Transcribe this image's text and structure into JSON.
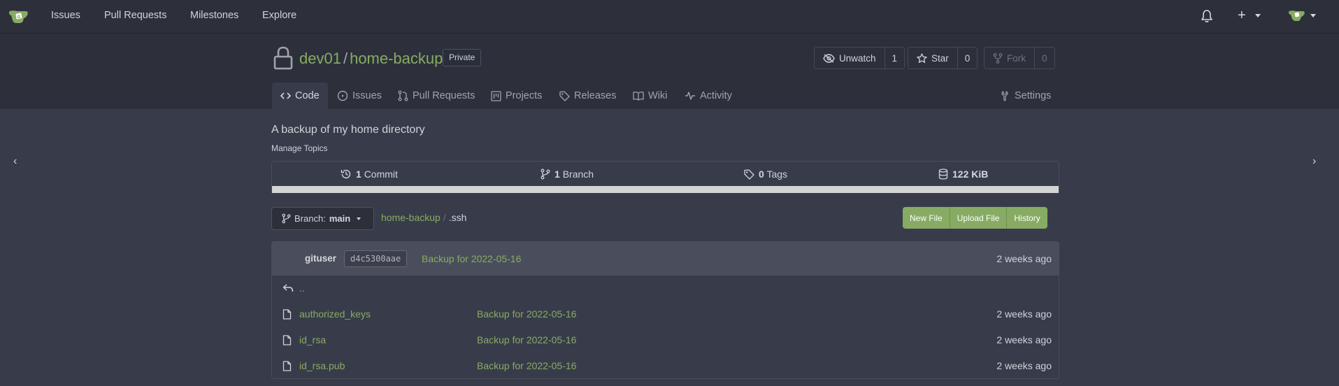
{
  "nav": {
    "links": [
      "Issues",
      "Pull Requests",
      "Milestones",
      "Explore"
    ],
    "add_icon": "plus-icon",
    "notifications_icon": "bell-icon"
  },
  "repo": {
    "owner": "dev01",
    "separator": "/",
    "name": "home-backup",
    "visibility": "Private",
    "watch": {
      "label": "Unwatch",
      "count": "1"
    },
    "star": {
      "label": "Star",
      "count": "0"
    },
    "fork": {
      "label": "Fork",
      "count": "0"
    }
  },
  "tabs": [
    {
      "label": "Code",
      "icon": "code-icon",
      "active": true
    },
    {
      "label": "Issues",
      "icon": "issue-icon"
    },
    {
      "label": "Pull Requests",
      "icon": "pull-request-icon"
    },
    {
      "label": "Projects",
      "icon": "project-icon"
    },
    {
      "label": "Releases",
      "icon": "tag-icon"
    },
    {
      "label": "Wiki",
      "icon": "book-icon"
    },
    {
      "label": "Activity",
      "icon": "pulse-icon"
    },
    {
      "label": "Settings",
      "icon": "tools-icon"
    }
  ],
  "description": "A backup of my home directory",
  "manage_topics": "Manage Topics",
  "stats": {
    "commits": {
      "count": "1",
      "label": "Commit"
    },
    "branches": {
      "count": "1",
      "label": "Branch"
    },
    "tags": {
      "count": "0",
      "label": "Tags"
    },
    "size": "122 KiB"
  },
  "branch": {
    "prefix": "Branch:",
    "name": "main"
  },
  "breadcrumb": {
    "root": "home-backup",
    "divider": "/",
    "current": ".ssh"
  },
  "actions": [
    "New File",
    "Upload File",
    "History"
  ],
  "latest_commit": {
    "author": "gituser",
    "sha": "d4c5300aae",
    "message": "Backup for 2022-05-16",
    "time": "2 weeks ago"
  },
  "parent_dir": "..",
  "files": [
    {
      "name": "authorized_keys",
      "message": "Backup for 2022-05-16",
      "time": "2 weeks ago"
    },
    {
      "name": "id_rsa",
      "message": "Backup for 2022-05-16",
      "time": "2 weeks ago"
    },
    {
      "name": "id_rsa.pub",
      "message": "Backup for 2022-05-16",
      "time": "2 weeks ago"
    }
  ],
  "colors": {
    "accent": "#87ab63",
    "background": "#383c4a",
    "header": "#2d303b"
  }
}
